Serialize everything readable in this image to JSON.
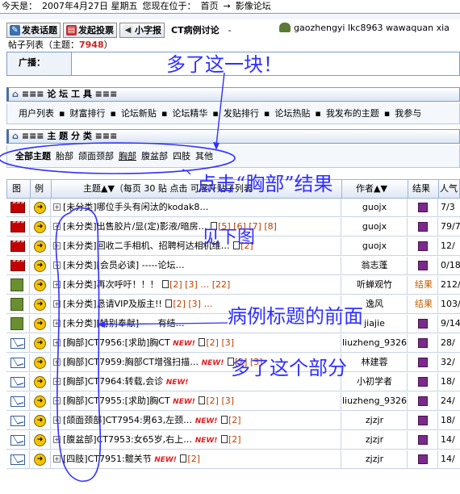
{
  "topbar": {
    "date_prefix": "今天是：",
    "date": "2007年4月27日 星期五",
    "location_label": "您现在位于：",
    "crumb_home": "首页",
    "crumb_arrow": "→",
    "crumb_forum": "影像论坛"
  },
  "toolbar": {
    "new_topic": "发表话题",
    "new_poll": "发起投票",
    "small_font": "小字报",
    "forum_name": "CT病例讨论",
    "dash": "-",
    "users": "gaozhengyi lkc8963 wawaquan xia"
  },
  "post_list": {
    "label": "帖子列表（主题：",
    "count": "7948",
    "close": "）"
  },
  "broadcast": {
    "label": "广播："
  },
  "tools_section": {
    "title": "≡≡≡ 论 坛 工 具 ≡≡≡",
    "items": [
      "用户列表",
      "▪",
      "财富排行",
      "▪",
      "论坛新贴",
      "▪",
      "论坛精华",
      "▪",
      "发贴排行",
      "▪",
      "论坛热贴",
      "▪",
      "我发布的主题",
      "▪",
      "我参与"
    ]
  },
  "category_section": {
    "title": "≡≡≡ 主 题 分 类 ≡≡≡",
    "items": [
      "全部主题",
      "胎部",
      "颌面颈部",
      "胸部",
      "腹盆部",
      "四肢",
      "其他"
    ],
    "active": "全部主题",
    "clicked": "胸部"
  },
  "table": {
    "headers": {
      "icon": "图",
      "example": "例",
      "topic": "主题▲▼（每页 30 贴  点击 可展开贴子列表",
      "author": "作者▲▼",
      "result": "结果",
      "views": "人气"
    },
    "rows": [
      {
        "icon": "hot",
        "title": "[未分类]哪位手头有闲汰的kodak8…",
        "pages": "",
        "author": "guojx",
        "result": "square",
        "views": "7/3"
      },
      {
        "icon": "hot",
        "title": "[未分类]出售胶片/显(定)影液/暗房…",
        "pages": "[5] [6] [7] [8]",
        "author": "guojx",
        "result": "square",
        "views": "79/7"
      },
      {
        "icon": "hot",
        "title": "[未分类]回收二手相机、招聘柯达相机维…",
        "pages": "[2]",
        "author": "guojx",
        "result": "square",
        "views": "12/"
      },
      {
        "icon": "hot",
        "title": "[未分类][会员必读] -----论坛…",
        "pages": "",
        "author": "翁志蓬",
        "result": "square",
        "views": "0/18"
      },
      {
        "icon": "star",
        "title": "[未分类]再次呼吁！！！",
        "pages": "[2] [3] … [22]",
        "author": "听蝉观竹",
        "result": "结果",
        "views": "212/"
      },
      {
        "icon": "star",
        "title": "[未分类]恳请VIP及版主!!",
        "pages": "[2] [3] …",
        "author": "逸风",
        "result": "结果",
        "views": "103/"
      },
      {
        "icon": "star",
        "title": "[未分类][特别奉献]----- 有结…",
        "pages": "",
        "author": "jiajie",
        "result": "square",
        "views": "9/14"
      },
      {
        "icon": "env",
        "title": "[胸部]CT7956:[求助]胸CT",
        "pages": "[2] [3]",
        "author": "liuzheng_9326",
        "result": "square",
        "views": "28/"
      },
      {
        "icon": "env",
        "title": "[胸部]CT7959:胸部CT增强扫描…",
        "pages": "[2] [3]",
        "author": "林建蓉",
        "result": "square",
        "views": "32/"
      },
      {
        "icon": "env",
        "title": "[胸部]CT7964:转载,会诊",
        "pages": "",
        "author": "小初学者",
        "result": "square",
        "views": "18/"
      },
      {
        "icon": "env",
        "title": "[胸部]CT7955:[求助]胸CT",
        "pages": "[2] [3]",
        "author": "liuzheng_9326",
        "result": "square",
        "views": "24/"
      },
      {
        "icon": "env",
        "title": "[颌面颈部]CT7954:男63,左颈…",
        "pages": "[2]",
        "author": "zjzjr",
        "result": "square",
        "views": "18/"
      },
      {
        "icon": "env",
        "title": "[腹盆部]CT7953:女65岁,右上…",
        "pages": "[2]",
        "author": "zjzjr",
        "result": "square",
        "views": "14/"
      },
      {
        "icon": "env",
        "title": "[四肢]CT7951:髋关节",
        "pages": "[2]",
        "author": "zjzjr",
        "result": "square",
        "views": "14/"
      }
    ],
    "new_label": "NEW!"
  },
  "annotations": {
    "a1": "多了这一块！",
    "a2": "点击“胸部”结果",
    "a3": "见下图",
    "a4": "病例标题的前面",
    "a5": "多了这个部分"
  }
}
